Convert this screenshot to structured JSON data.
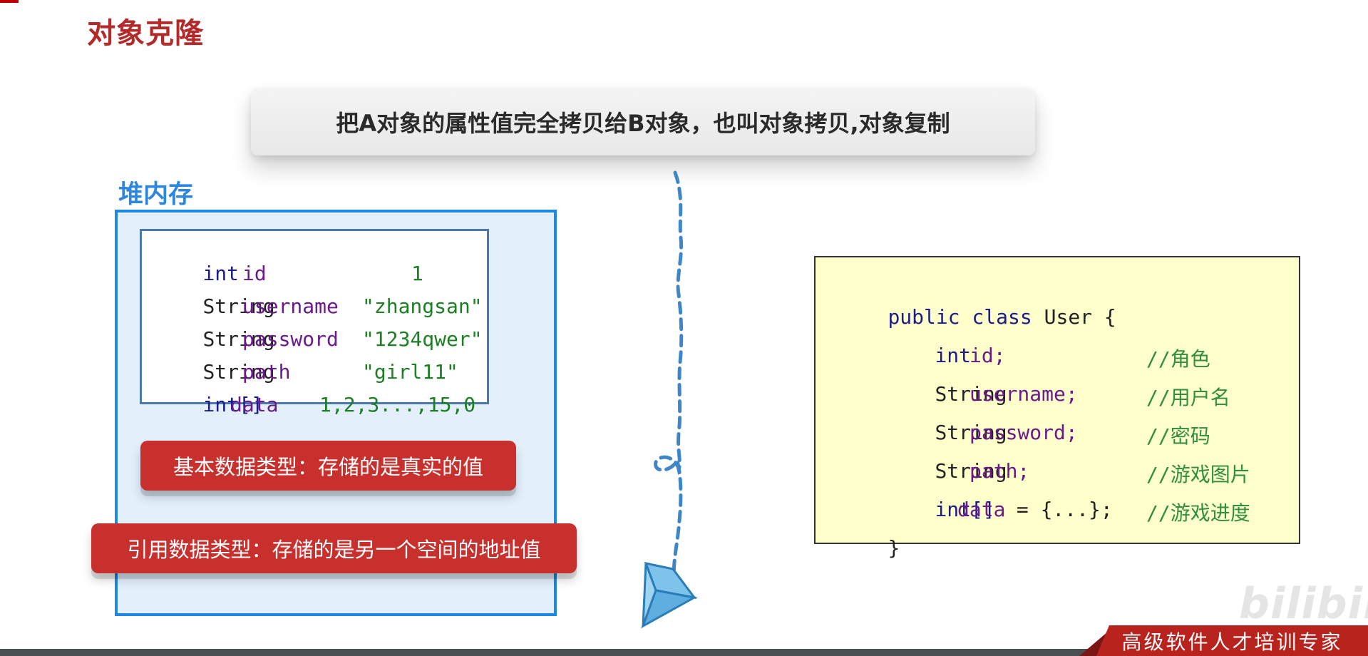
{
  "slide": {
    "title": "对象克隆",
    "banner": "把A对象的属性值完全拷贝给B对象，也叫对象拷贝,对象复制",
    "heap_label": "堆内存"
  },
  "heap_object": {
    "rows": [
      {
        "type": "int",
        "name": "id",
        "value": "1"
      },
      {
        "type": "String",
        "name": "username",
        "value": "\"zhangsan\""
      },
      {
        "type": "String",
        "name": "password",
        "value": "\"1234qwer\""
      },
      {
        "type": "String",
        "name": "path",
        "value": "\"girl11\""
      },
      {
        "type": "int[]",
        "name": "data",
        "value": "1,2,3...,15,0"
      }
    ]
  },
  "notes": {
    "primitive": "基本数据类型：存储的是真实的值",
    "reference": "引用数据类型：存储的是另一个空间的地址值"
  },
  "code": {
    "line1_kw1": "public",
    "line1_kw2": "class",
    "line1_rest": "User {",
    "fields": [
      {
        "type": "int",
        "name": "id;",
        "comment": "//角色"
      },
      {
        "type": "String",
        "name": "username;",
        "comment": "//用户名"
      },
      {
        "type": "String",
        "name": "password;",
        "comment": "//密码"
      },
      {
        "type": "String",
        "name": "path;",
        "comment": "//游戏图片"
      },
      {
        "type": "int[]",
        "name": "data",
        "rest": " = {...};",
        "comment": "//游戏进度"
      }
    ],
    "close": "}"
  },
  "footer": {
    "tagline": "高级软件人才培训专家",
    "watermark": "bilibili"
  },
  "colors": {
    "title_red": "#b22a2a",
    "heap_blue": "#1e88e5",
    "pill_red": "#c8302e",
    "code_bg": "#ffffcc",
    "arrow_blue": "#3f86c8"
  }
}
